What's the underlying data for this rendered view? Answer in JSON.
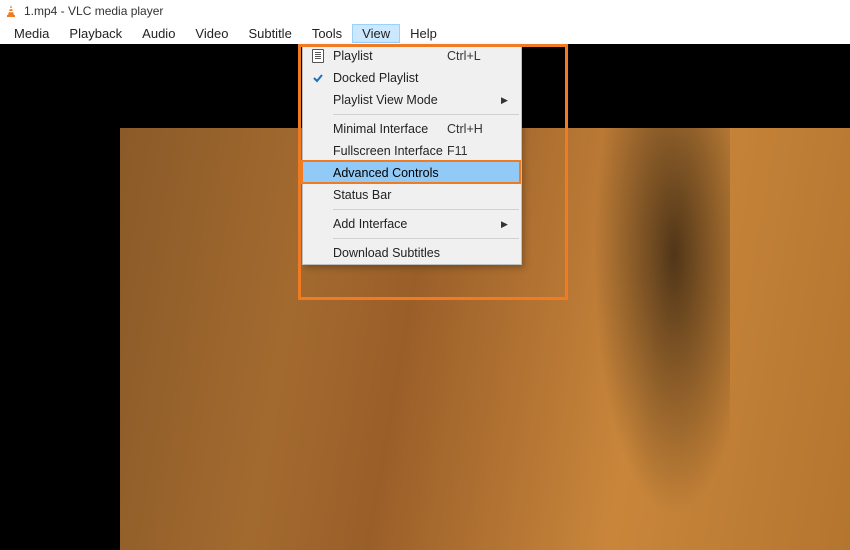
{
  "title_bar": {
    "text": "1.mp4 - VLC media player"
  },
  "menu_bar": {
    "items": [
      {
        "label": "Media"
      },
      {
        "label": "Playback"
      },
      {
        "label": "Audio"
      },
      {
        "label": "Video"
      },
      {
        "label": "Subtitle"
      },
      {
        "label": "Tools"
      },
      {
        "label": "View",
        "open": true
      },
      {
        "label": "Help"
      }
    ]
  },
  "view_menu": {
    "items": [
      {
        "label": "Playlist",
        "accel": "Ctrl+L",
        "icon": "playlist"
      },
      {
        "label": "Docked Playlist",
        "icon": "check"
      },
      {
        "label": "Playlist View Mode",
        "submenu": true
      },
      {
        "sep": true
      },
      {
        "label": "Minimal Interface",
        "accel": "Ctrl+H"
      },
      {
        "label": "Fullscreen Interface",
        "accel": "F11"
      },
      {
        "label": "Advanced Controls",
        "selected": true
      },
      {
        "label": "Status Bar"
      },
      {
        "sep": true
      },
      {
        "label": "Add Interface",
        "submenu": true
      },
      {
        "sep": true
      },
      {
        "label": "Download Subtitles"
      }
    ]
  }
}
